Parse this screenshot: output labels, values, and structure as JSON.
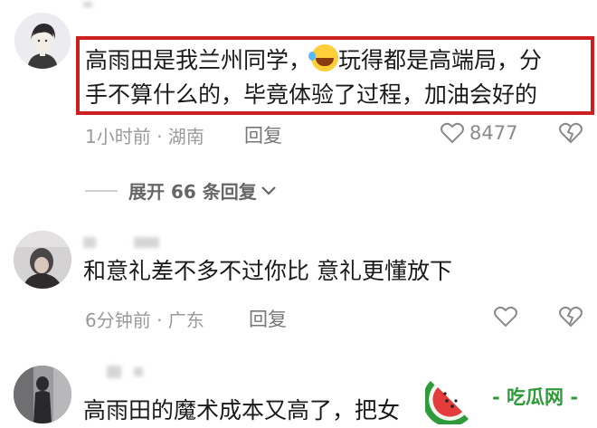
{
  "comments": [
    {
      "text_part1": "高雨田是我兰州同学，",
      "emoji": "laughing-tears-icon",
      "text_part2": "玩得都是高端局，分",
      "text_line2": "手不算什么的，毕竟体验了过程，加油会好的",
      "meta": "1小时前 · 湖南",
      "reply": "回复",
      "likes": "8477",
      "expand": "展开 66 条回复"
    },
    {
      "text": "和意礼差不多不过你比 意礼更懂放下",
      "meta": "6分钟前 · 广东",
      "reply": "回复"
    },
    {
      "text": "高雨田的魔术成本又高了，把女"
    }
  ],
  "watermark": {
    "text": "- 吃瓜网 -"
  },
  "colors": {
    "highlight": "#cc1f1f",
    "meta": "#9a9a9a",
    "watermark": "#2f9a3a"
  }
}
